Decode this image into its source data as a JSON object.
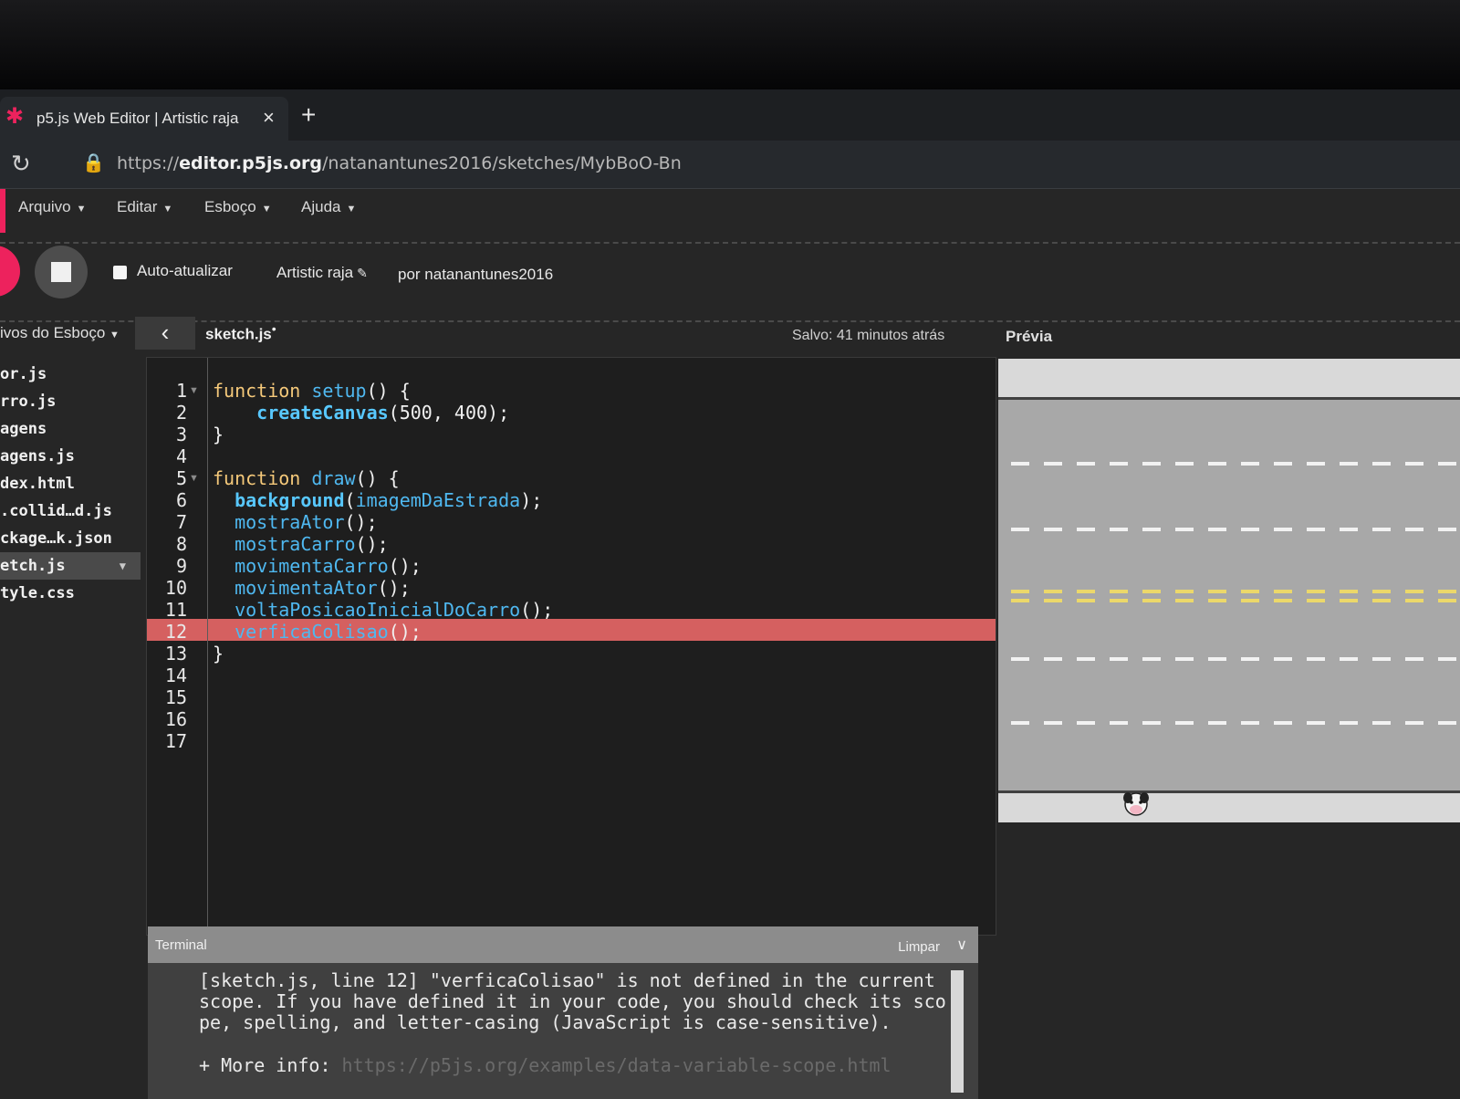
{
  "browser": {
    "tab_title": "p5.js Web Editor | Artistic raja",
    "tab_close": "×",
    "new_tab": "+",
    "url_prefix": "https://",
    "url_domain": "editor.p5js.org",
    "url_path": "/natanantunes2016/sketches/MybBoO-Bn"
  },
  "menu": {
    "items": [
      {
        "label": "Arquivo"
      },
      {
        "label": "Editar"
      },
      {
        "label": "Esboço"
      },
      {
        "label": "Ajuda"
      }
    ]
  },
  "toolbar": {
    "auto_refresh_label": "Auto-atualizar",
    "sketch_name": "Artistic raja",
    "author": "por natanantunes2016"
  },
  "sidebar": {
    "header": "ivos do Esboço",
    "files": [
      {
        "name": "or.js",
        "active": false
      },
      {
        "name": "rro.js",
        "active": false
      },
      {
        "name": "agens",
        "active": false
      },
      {
        "name": "agens.js",
        "active": false
      },
      {
        "name": "dex.html",
        "active": false
      },
      {
        "name": ".collid…d.js",
        "active": false
      },
      {
        "name": "ckage…k.json",
        "active": false
      },
      {
        "name": "etch.js",
        "active": true
      },
      {
        "name": "tyle.css",
        "active": false
      }
    ]
  },
  "editor": {
    "file_tab": "sketch.js",
    "unsaved_marker": "•",
    "saved_status": "Salvo: 41 minutos atrás",
    "error_line": 12,
    "line_numbers": [
      "1",
      "2",
      "3",
      "4",
      "5",
      "6",
      "7",
      "8",
      "9",
      "10",
      "11",
      "12",
      "13",
      "14",
      "15",
      "16",
      "17"
    ],
    "code": {
      "l1_kw": "function",
      "l1_fn": "setup",
      "l1_rest": "() {",
      "l2_fn": "createCanvas",
      "l2_rest": "(500, 400);",
      "l3": "}",
      "l5_kw": "function",
      "l5_fn": "draw",
      "l5_rest": "() {",
      "l6_fn": "background",
      "l6_arg": "imagemDaEstrada",
      "l6_rest": ");",
      "l7_fn": "mostraAtor",
      "l8_fn": "mostraCarro",
      "l9_fn": "movimentaCarro",
      "l10_fn": "movimentaAtor",
      "l11_fn": "voltaPosicaoInicialDoCarro",
      "l12_fn": "verficaColisao",
      "call_suffix": "();",
      "l13": "}"
    }
  },
  "preview": {
    "label": "Prévia"
  },
  "terminal": {
    "title": "Terminal",
    "clear_label": "Limpar",
    "message": "[sketch.js, line 12] \"verficaColisao\" is not defined in the current scope. If you have defined it in your code, you should check its sco pe, spelling, and letter-casing (JavaScript is case-sensitive).",
    "more_info_label": "+ More info:",
    "more_info_link": "https://p5js.org/examples/data-variable-scope.html"
  },
  "colors": {
    "accent": "#ed225d",
    "keyword": "#f5c97a",
    "function": "#4fb8f0",
    "error_highlight": "#d56060",
    "lane_white": "#f2f2f2",
    "lane_yellow": "#ecd86a"
  },
  "icons": {
    "favicon": "p5-asterisk-icon",
    "reload": "reload-icon",
    "lock": "lock-icon",
    "caret": "caret-down-icon",
    "collapse": "chevron-left-icon",
    "pencil": "pencil-icon",
    "terminal_toggle": "chevron-down-icon"
  }
}
